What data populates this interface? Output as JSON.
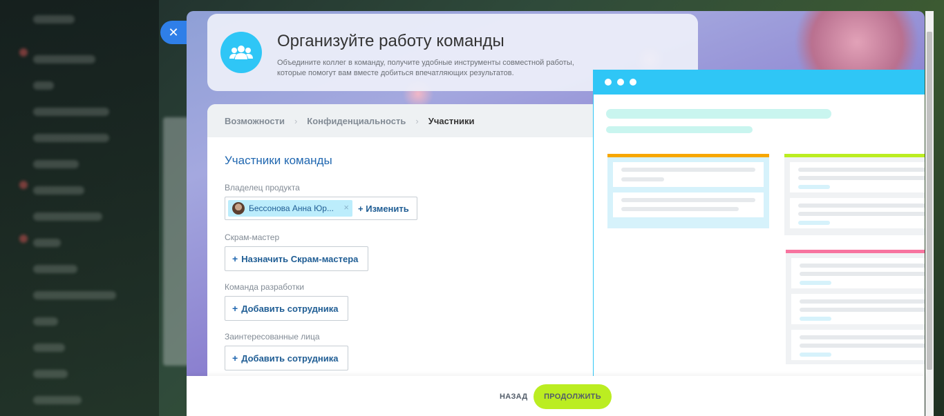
{
  "hero": {
    "title": "Организуйте работу команды",
    "description": "Объедините коллег в команду, получите удобные инструменты совместной работы, которые помогут вам вместе добиться впечатляющих результатов."
  },
  "breadcrumbs": [
    "Возможности",
    "Конфиденциальность",
    "Участники"
  ],
  "section_title": "Участники команды",
  "fields": {
    "owner": {
      "label": "Владелец продукта",
      "selected": "Бессонова Анна Юр...",
      "change_label": "Изменить"
    },
    "scrum_master": {
      "label": "Скрам-мастер",
      "button": "Назначить Скрам-мастера"
    },
    "dev_team": {
      "label": "Команда разработки",
      "button": "Добавить сотрудника"
    },
    "stakeholders": {
      "label": "Заинтересованные лица",
      "button": "Добавить сотрудника"
    }
  },
  "footer": {
    "back_label": "НАЗАД",
    "next_label": "ПРОДОЛЖИТЬ"
  },
  "icons": {
    "close": "close-icon",
    "team": "team-icon",
    "plus": "plus-icon",
    "remove": "remove-icon"
  },
  "colors": {
    "accent": "#2fc6f6",
    "primary_button": "#bbed21",
    "link": "#2067b0",
    "close_button": "#2f7fe8",
    "column_orange": "#f7a700",
    "column_green": "#bbed21",
    "column_pink": "#f7749f"
  }
}
